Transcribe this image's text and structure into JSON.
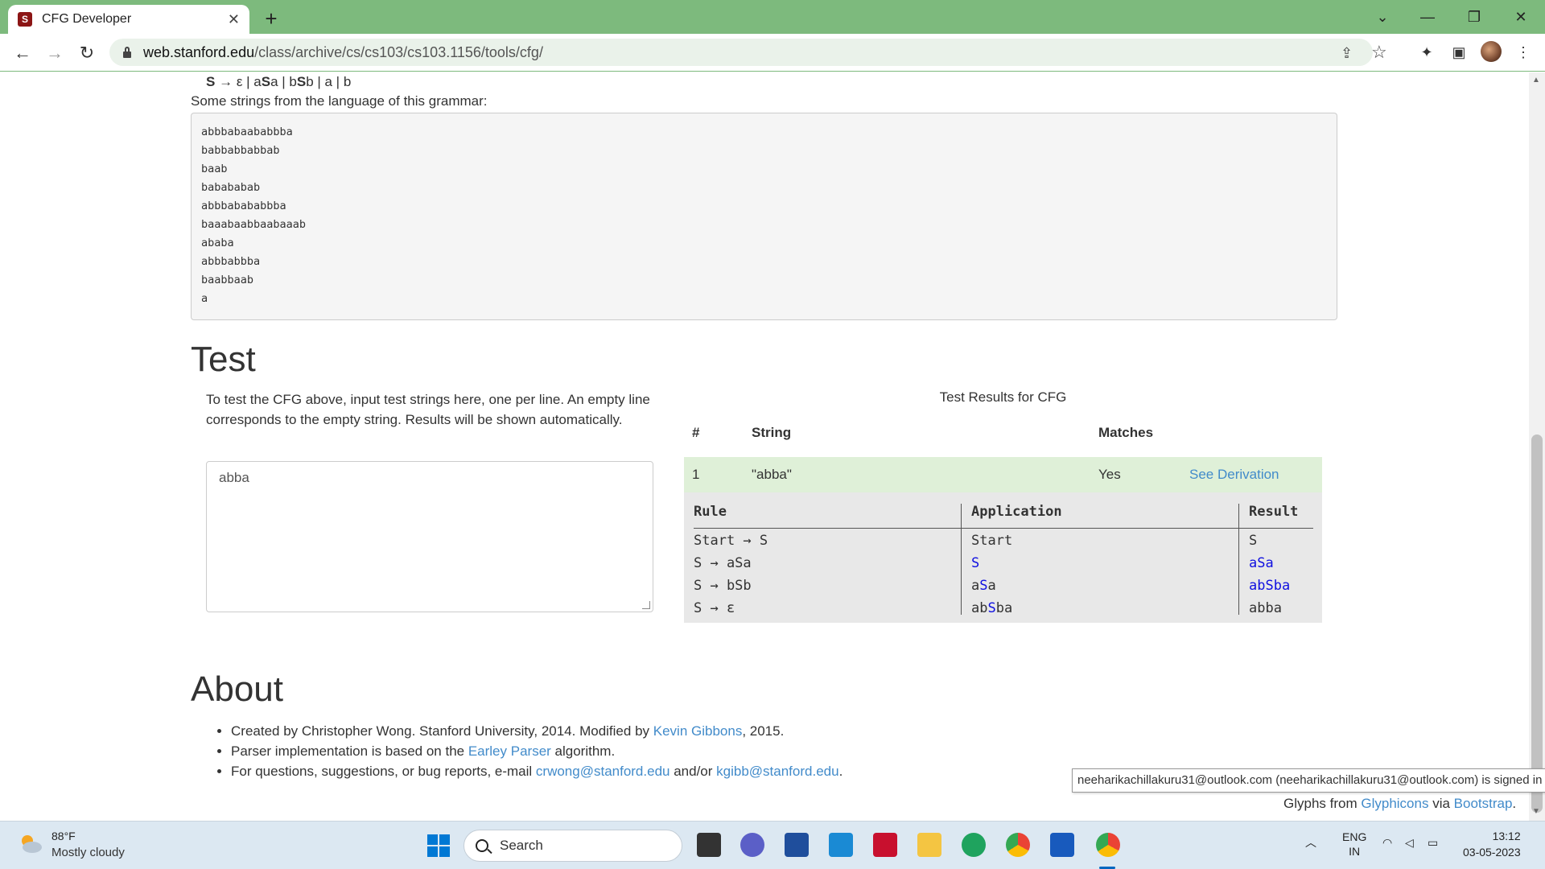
{
  "browser": {
    "tab_title": "CFG Developer",
    "url_host": "web.stanford.edu",
    "url_path": "/class/archive/cs/cs103/cs103.1156/tools/cfg/"
  },
  "grammar": {
    "start": "S",
    "arrow": "→",
    "eps": "ε | a",
    "s1": "S",
    "mid1": "a | b",
    "s2": "S",
    "rest": "b | a | b"
  },
  "strings_intro": "Some strings from the language of this grammar:",
  "sample_strings": [
    "abbbabaababbba",
    "babbabbabbab",
    "baab",
    "babababab",
    "abbbabababbba",
    "baaabaabbaabaaab",
    "ababa",
    "abbbabbba",
    "baabbaab",
    "a"
  ],
  "test": {
    "heading": "Test",
    "instructions": "To test the CFG above, input test strings here, one per line. An empty line corresponds to the empty string. Results will be shown automatically.",
    "input_value": "abba"
  },
  "results": {
    "title": "Test Results for CFG",
    "col_num": "#",
    "col_string": "String",
    "col_matches": "Matches",
    "row_num": "1",
    "row_string": "\"abba\"",
    "row_match": "Yes",
    "row_link": "See Derivation"
  },
  "derivation": {
    "col_rule": "Rule",
    "col_app": "Application",
    "col_result": "Result",
    "rules": [
      "Start → S",
      "S → aSa",
      "S → bSb",
      "S → ε"
    ],
    "apps": [
      {
        "pre": "Start",
        "hl": "",
        "post": ""
      },
      {
        "pre": "",
        "hl": "S",
        "post": ""
      },
      {
        "pre": "a",
        "hl": "S",
        "post": "a"
      },
      {
        "pre": "ab",
        "hl": "S",
        "post": "ba"
      }
    ],
    "results": [
      {
        "pre": "S",
        "hl": "",
        "post": ""
      },
      {
        "pre": "",
        "hl": "aSa",
        "post": ""
      },
      {
        "pre": "ab",
        "hl": "S",
        "post": "ba"
      },
      {
        "pre": "abba",
        "hl": "",
        "post": ""
      }
    ],
    "result_2_pre_hl": "ab",
    "result_2_hl": "S",
    "result_2_post_hl": "ba"
  },
  "about": {
    "heading": "About",
    "line1_pre": "Created by Christopher Wong. Stanford University, 2014. Modified by ",
    "line1_link": "Kevin Gibbons",
    "line1_post": ", 2015.",
    "line2_pre": "Parser implementation is based on the ",
    "line2_link": "Earley Parser",
    "line2_post": " algorithm.",
    "line3_pre": "For questions, suggestions, or bug reports, e-mail ",
    "line3_link1": "crwong@stanford.edu",
    "line3_mid": " and/or ",
    "line3_link2": "kgibb@stanford.edu",
    "line3_post": "."
  },
  "tooltip": "neeharikachillakuru31@outlook.com (neeharikachillakuru31@outlook.com) is signed in",
  "glyphs": {
    "pre": "Glyphs from ",
    "link1": "Glyphicons",
    "mid": " via ",
    "link2": "Bootstrap",
    "post": "."
  },
  "taskbar": {
    "temp": "88°F",
    "weather": "Mostly cloudy",
    "search": "Search",
    "lang1": "ENG",
    "lang2": "IN",
    "time": "13:12",
    "date": "03-05-2023"
  },
  "colors": {
    "accent_green": "#7dba7d",
    "link": "#428bca",
    "match_row": "#dff0d8",
    "highlight": "#1010e0"
  }
}
